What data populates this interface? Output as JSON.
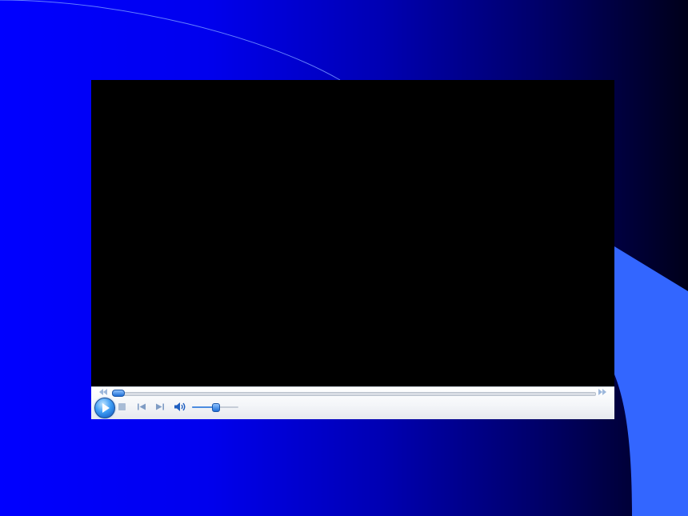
{
  "colors": {
    "background_left": "#0000ff",
    "background_right": "#00001a",
    "accent_shape": "#3366ff",
    "video_area": "#000000",
    "controls_bar": "#f0f2f6",
    "control_accent": "#1f6fd6"
  },
  "player": {
    "seek": {
      "progress": 0.0
    },
    "volume": {
      "level": 0.5
    },
    "icons": {
      "rewind": "rewind-icon",
      "fast_forward": "fast-forward-icon",
      "play": "play-icon",
      "stop": "stop-icon",
      "previous": "previous-icon",
      "next": "next-icon",
      "mute": "speaker-icon"
    }
  }
}
